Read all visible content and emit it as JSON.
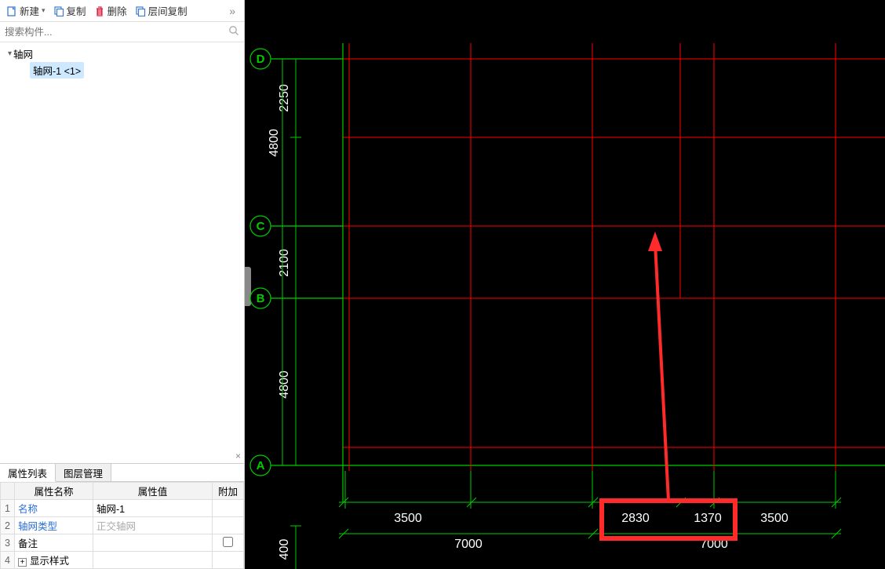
{
  "toolbar": {
    "new": "新建",
    "copy": "复制",
    "delete": "删除",
    "layercopy": "层间复制"
  },
  "search": {
    "placeholder": "搜索构件..."
  },
  "tree": {
    "root": "轴网",
    "child": "轴网-1 <1>"
  },
  "tabs": {
    "prop": "属性列表",
    "layer": "图层管理"
  },
  "prop": {
    "col_name": "属性名称",
    "col_value": "属性值",
    "col_extra": "附加",
    "rows": {
      "r1": {
        "n": "1",
        "name": "名称",
        "value": "轴网-1"
      },
      "r2": {
        "n": "2",
        "name": "轴网类型",
        "value": "正交轴网"
      },
      "r3": {
        "n": "3",
        "name": "备注",
        "value": ""
      },
      "r4": {
        "n": "4",
        "name": "显示样式",
        "value": ""
      }
    }
  },
  "axes": {
    "A": "A",
    "B": "B",
    "C": "C",
    "D": "D"
  },
  "vdims": {
    "d_ab": "4800",
    "d_bc": "2100",
    "d_cd": "4800",
    "d_cd_upper": "2250"
  },
  "hdims": {
    "top_3500a": "3500",
    "top_2830": "2830",
    "top_1370": "1370",
    "top_3500b": "3500",
    "bot_7000a": "7000",
    "bot_7000b": "7000",
    "far_400": "400"
  }
}
